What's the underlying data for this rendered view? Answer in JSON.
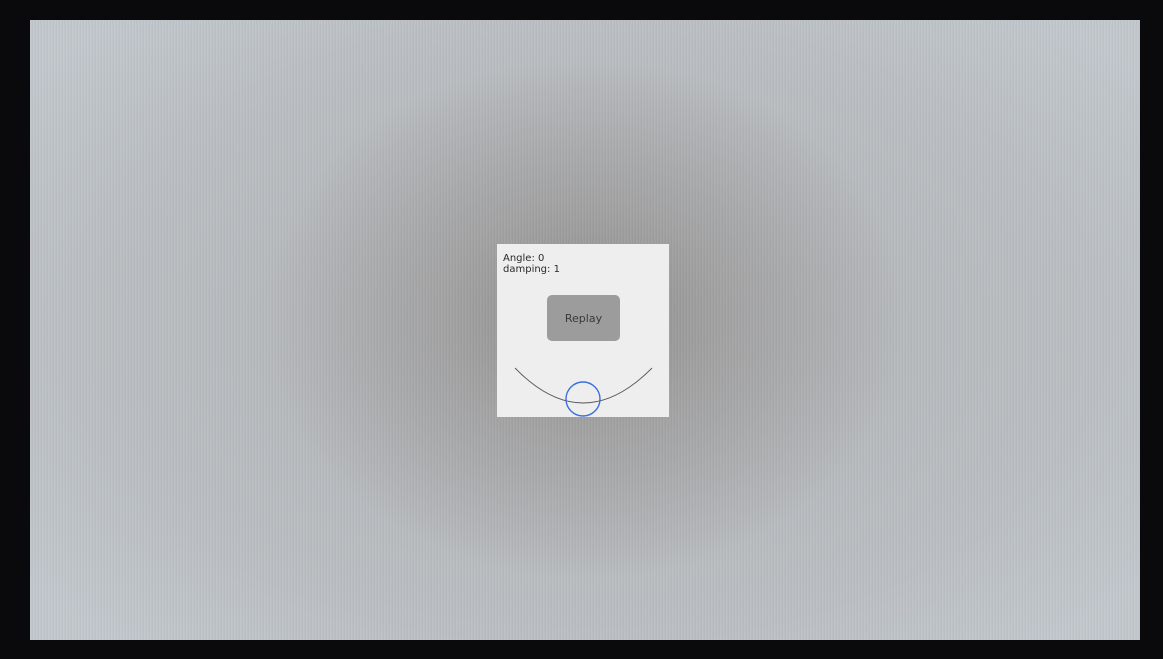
{
  "status": {
    "angle_label": "Angle: 0",
    "damping_label": "damping: 1"
  },
  "controls": {
    "replay_label": "Replay"
  },
  "colors": {
    "panel_background": "#eeeeee",
    "button_background": "#9c9c9c",
    "ball_stroke": "#3a6fe0",
    "track_stroke": "#555555"
  },
  "icons": {
    "track": "arc-track-icon",
    "ball": "ball-circle-icon"
  }
}
